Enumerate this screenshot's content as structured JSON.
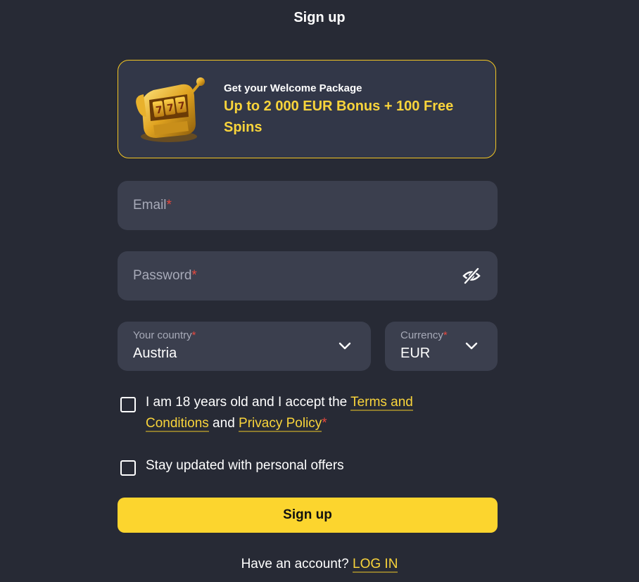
{
  "title": "Sign up",
  "promo": {
    "image_icon": "slot-machine-icon",
    "subtitle": "Get your Welcome Package",
    "headline": "Up to 2 000 EUR Bonus + 100 Free Spins"
  },
  "form": {
    "email": {
      "label": "Email",
      "required_mark": "*",
      "value": ""
    },
    "password": {
      "label": "Password",
      "required_mark": "*",
      "value": "",
      "toggle_icon": "eye-off-icon"
    },
    "country": {
      "label": "Your country",
      "required_mark": "*",
      "value": "Austria",
      "icon": "chevron-down-icon"
    },
    "currency": {
      "label": "Currency",
      "required_mark": "*",
      "value": "EUR",
      "icon": "chevron-down-icon"
    },
    "terms": {
      "prefix": "I am 18 years old and I accept the ",
      "terms_link": "Terms and Conditions",
      "middle": " and ",
      "privacy_link": "Privacy Policy",
      "required_mark": "*",
      "checked": false
    },
    "offers": {
      "label": "Stay updated with personal offers",
      "checked": false
    },
    "submit_label": "Sign up"
  },
  "footer": {
    "prompt": "Have an account? ",
    "login_link": "LOG IN"
  },
  "colors": {
    "background": "#272a35",
    "field": "#3b3f4e",
    "accent": "#fcd52e",
    "link": "#f9d43b",
    "required": "#e5483e"
  }
}
